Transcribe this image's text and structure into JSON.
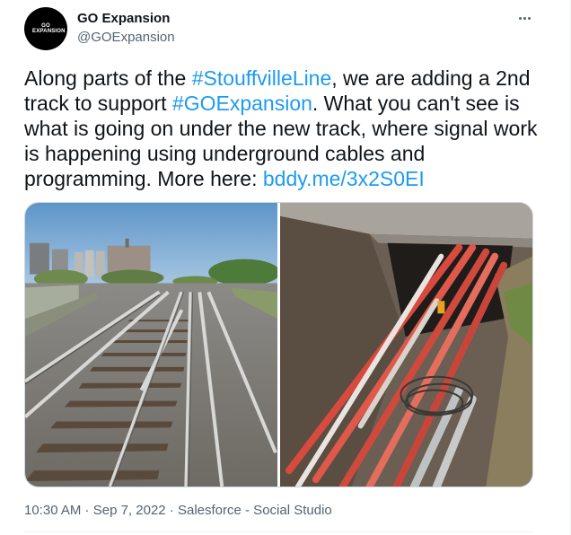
{
  "author": {
    "name": "GO Expansion",
    "handle": "@GOExpansion",
    "avatar_text": "GO EXPANSION"
  },
  "tweet": {
    "text_1": "Along parts of the ",
    "hashtag_1": "#StouffvilleLine",
    "text_2": ", we are adding a 2nd track to support ",
    "hashtag_2": "#GOExpansion",
    "text_3": ". What you can't see is what is going on under the new track, where signal work is happening using underground cables and programming. More here: ",
    "link": "bddy.me/3x2S0EI"
  },
  "media": {
    "photos": [
      {
        "icon": "railway-tracks-photo"
      },
      {
        "icon": "underground-cables-photo"
      }
    ]
  },
  "meta": {
    "time": "10:30 AM",
    "separator": " · ",
    "date": "Sep 7, 2022",
    "source": "Salesforce - Social Studio"
  },
  "colors": {
    "link": "#1d9bf0",
    "text": "#0f1419",
    "secondary": "#536471"
  }
}
